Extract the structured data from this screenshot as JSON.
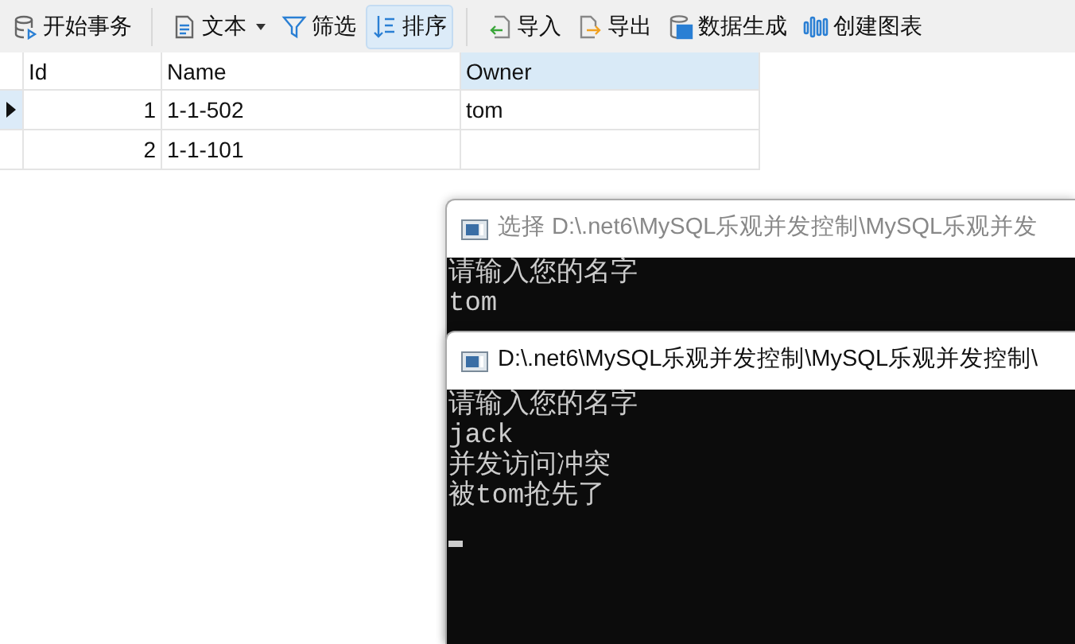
{
  "toolbar": [
    {
      "kind": "button",
      "label": "开始事务",
      "active": false
    },
    {
      "kind": "divider"
    },
    {
      "kind": "dropdown",
      "label": "文本",
      "active": false
    },
    {
      "kind": "button",
      "label": "筛选",
      "active": false
    },
    {
      "kind": "button",
      "label": "排序",
      "active": true
    },
    {
      "kind": "divider"
    },
    {
      "kind": "button",
      "label": "导入",
      "active": false
    },
    {
      "kind": "button",
      "label": "导出",
      "active": false
    },
    {
      "kind": "button",
      "label": "数据生成",
      "active": false
    },
    {
      "kind": "button",
      "label": "创建图表",
      "active": false
    }
  ],
  "table": {
    "columns": [
      {
        "label": "Id",
        "selected": false
      },
      {
        "label": "Name",
        "selected": false
      },
      {
        "label": "Owner",
        "selected": true
      }
    ],
    "rows": [
      {
        "current": true,
        "cells": [
          "1",
          "1-1-502",
          "tom"
        ]
      },
      {
        "current": false,
        "cells": [
          "2",
          "1-1-101",
          ""
        ]
      }
    ]
  },
  "consoles": [
    {
      "title": "选择 D:\\.net6\\MySQL乐观并发控制\\MySQL乐观并发",
      "lines": [
        "请输入您的名字",
        "tom"
      ]
    },
    {
      "title": "D:\\.net6\\MySQL乐观并发控制\\MySQL乐观并发控制\\",
      "lines": [
        "请输入您的名字",
        "jack",
        "并发访问冲突",
        "被tom抢先了"
      ]
    }
  ]
}
